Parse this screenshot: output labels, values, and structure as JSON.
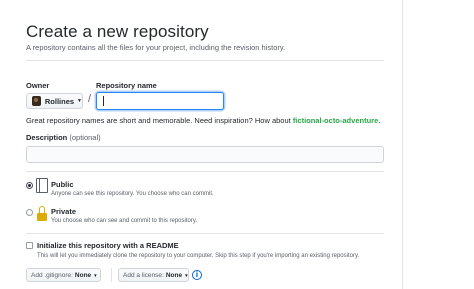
{
  "page": {
    "title": "Create a new repository",
    "subtitle": "A repository contains all the files for your project, including the revision history."
  },
  "owner": {
    "label": "Owner",
    "value": "Rollines",
    "caret": "▼"
  },
  "separator": "/",
  "repository": {
    "label": "Repository name",
    "value": ""
  },
  "hint": {
    "text": "Great repository names are short and memorable. Need inspiration? How about ",
    "suggestion": "fictional-octo-adventure",
    "end": "."
  },
  "description": {
    "label": "Description",
    "optional": "(optional)",
    "value": ""
  },
  "visibility": {
    "public": {
      "title": "Public",
      "desc": "Anyone can see this repository. You choose who can commit.",
      "icon": "repo-book-icon",
      "checked": true
    },
    "private": {
      "title": "Private",
      "desc": "You choose who can see and commit to this repository.",
      "icon": "lock-icon",
      "checked": false
    }
  },
  "initialize": {
    "title": "Initialize this repository with a README",
    "desc": "This will let you immediately clone the repository to your computer. Skip this step if you're importing an existing repository.",
    "checked": false
  },
  "gitignore": {
    "prefix": "Add .gitignore:",
    "value": "None",
    "caret": "▼"
  },
  "license": {
    "prefix": "Add a license:",
    "value": "None",
    "caret": "▼"
  },
  "info_icon": {
    "glyph": "i"
  },
  "colors": {
    "accent": "#2188ff",
    "suggestion": "#28a745",
    "lock": "#dbab09"
  }
}
